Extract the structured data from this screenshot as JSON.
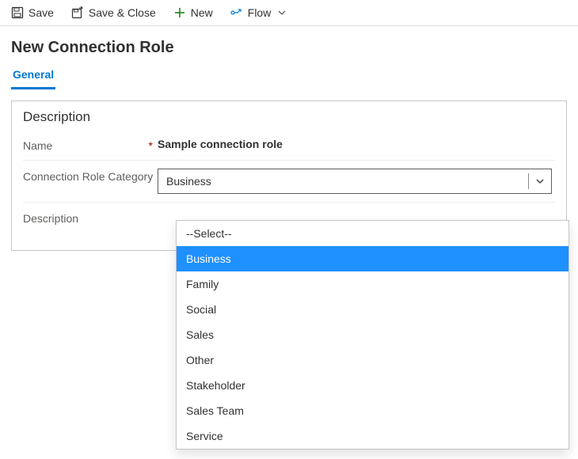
{
  "toolbar": {
    "save": "Save",
    "save_close": "Save & Close",
    "new": "New",
    "flow": "Flow"
  },
  "page_title": "New Connection Role",
  "tabs": {
    "general": "General"
  },
  "section": {
    "title": "Description",
    "name_label": "Name",
    "name_value": "Sample connection role",
    "category_label": "Connection Role Category",
    "category_value": "Business",
    "description_label": "Description"
  },
  "dropdown": {
    "options": [
      "--Select--",
      "Business",
      "Family",
      "Social",
      "Sales",
      "Other",
      "Stakeholder",
      "Sales Team",
      "Service"
    ],
    "selected_index": 1
  },
  "colors": {
    "accent": "#0078d4",
    "highlight": "#1e90ff"
  }
}
